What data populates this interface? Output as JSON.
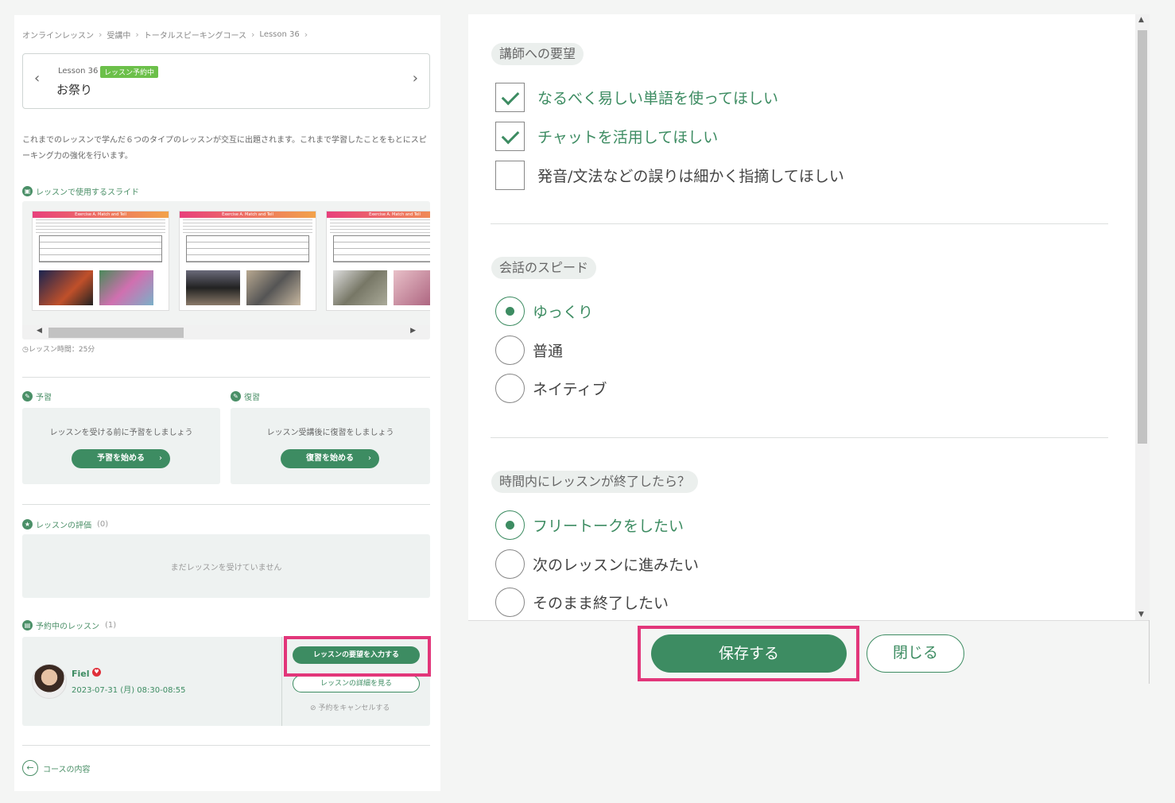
{
  "breadcrumb": [
    "オンラインレッスン",
    "受講中",
    "トータルスピーキングコース",
    "Lesson 36"
  ],
  "lesson": {
    "number": "Lesson 36",
    "status_tag": "レッスン予約中",
    "title": "お祭り"
  },
  "description": "これまでのレッスンで学んだ６つのタイプのレッスンが交互に出題されます。これまで学習したことをもとにスピーキング力の強化を行います。",
  "slides": {
    "title": "レッスンで使用するスライド",
    "slide_header": "Exercise A. Match and Tell",
    "time_note": "レッスン時間：25分"
  },
  "preview": {
    "title": "予習",
    "message": "レッスンを受ける前に予習をしましょう",
    "button": "予習を始める"
  },
  "review": {
    "title": "復習",
    "message": "レッスン受講後に復習をしましょう",
    "button": "復習を始める"
  },
  "rating": {
    "title": "レッスンの評価",
    "count": "(0)",
    "message": "まだレッスンを受けていません"
  },
  "reserved": {
    "title": "予約中のレッスン",
    "count": "(1)",
    "tutor": "Fiel",
    "datetime": "2023-07-31 (月) 08:30-08:55",
    "request_button": "レッスンの要望を入力する",
    "detail_button": "レッスンの詳細を見る",
    "cancel_link": "予約をキャンセルする"
  },
  "back_link": "コースの内容",
  "requests": {
    "title": "講師への要望",
    "options": [
      {
        "label": "なるべく易しい単語を使ってほしい",
        "checked": true
      },
      {
        "label": "チャットを活用してほしい",
        "checked": true
      },
      {
        "label": "発音/文法などの誤りは細かく指摘してほしい",
        "checked": false
      }
    ]
  },
  "speed": {
    "title": "会話のスピード",
    "options": [
      {
        "label": "ゆっくり",
        "selected": true
      },
      {
        "label": "普通",
        "selected": false
      },
      {
        "label": "ネイティブ",
        "selected": false
      }
    ]
  },
  "early_finish": {
    "title": "時間内にレッスンが終了したら？",
    "options": [
      {
        "label": "フリートークをしたい",
        "selected": true
      },
      {
        "label": "次のレッスンに進みたい",
        "selected": false
      },
      {
        "label": "そのまま終了したい",
        "selected": false
      }
    ]
  },
  "footer": {
    "save": "保存する",
    "close": "閉じる"
  },
  "colors": {
    "accent": "#3d8c62",
    "highlight": "#e2367a",
    "tag": "#6cc04a"
  }
}
